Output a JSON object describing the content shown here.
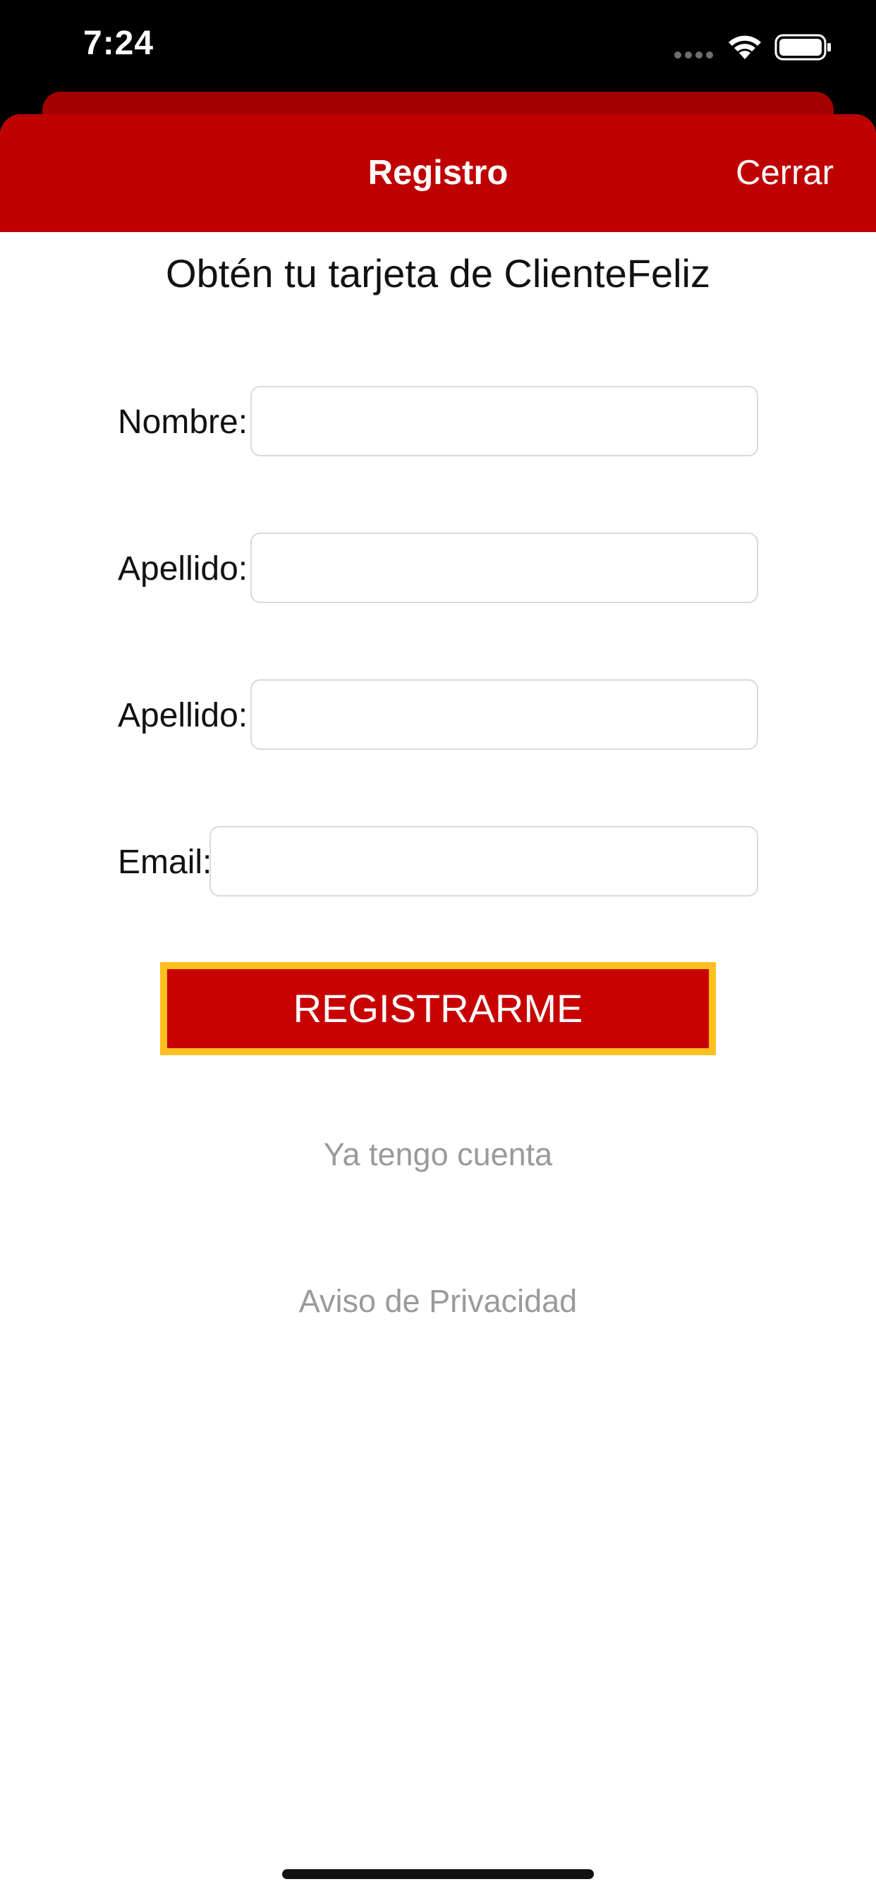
{
  "status_bar": {
    "time": "7:24",
    "icons": [
      "signal-icon",
      "wifi-icon",
      "battery-icon"
    ]
  },
  "nav": {
    "title": "Registro",
    "close_label": "Cerrar"
  },
  "heading": "Obtén tu tarjeta de ClienteFeliz",
  "form": {
    "fields": [
      {
        "label": "Nombre:",
        "value": "",
        "placeholder": ""
      },
      {
        "label": "Apellido:",
        "value": "",
        "placeholder": ""
      },
      {
        "label": "Apellido:",
        "value": "",
        "placeholder": ""
      },
      {
        "label": "Email:",
        "value": "",
        "placeholder": ""
      }
    ],
    "submit_label": "REGISTRARME"
  },
  "links": {
    "have_account": "Ya tengo cuenta",
    "privacy": "Aviso de Privacidad"
  },
  "colors": {
    "nav_background": "#bf0000",
    "button_background": "#c80000",
    "button_border": "#ffbf1f",
    "link_text": "#9a9a9a"
  }
}
